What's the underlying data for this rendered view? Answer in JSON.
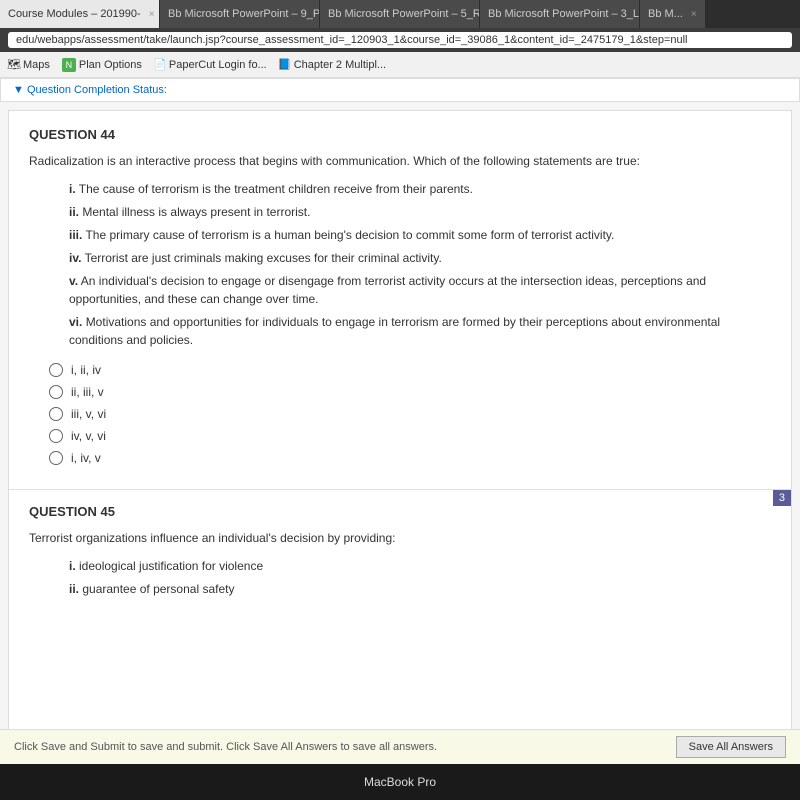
{
  "browser": {
    "tabs": [
      {
        "label": "Course Modules – 201990-",
        "active": true,
        "close": "×"
      },
      {
        "label": "Bb Microsoft PowerPoint – 9_P...",
        "active": false,
        "close": "×"
      },
      {
        "label": "Bb Microsoft PowerPoint – 5_R...",
        "active": false,
        "close": "×"
      },
      {
        "label": "Bb Microsoft PowerPoint – 3_L...",
        "active": false,
        "close": "×"
      },
      {
        "label": "Bb M...",
        "active": false,
        "close": "×"
      }
    ],
    "address": "edu/webapps/assessment/take/launch.jsp?course_assessment_id=_120903_1&course_id=_39086_1&content_id=_2475179_1&step=null",
    "bookmarks": [
      {
        "label": "Maps",
        "icon": "🗺"
      },
      {
        "label": "Plan Options",
        "icon": "🅝"
      },
      {
        "label": "PaperCut Login fo...",
        "icon": "📄"
      },
      {
        "label": "Chapter 2 Multipl...",
        "icon": "📘"
      }
    ]
  },
  "page": {
    "completion_status": "▼ Question Completion Status:",
    "questions": [
      {
        "number": "QUESTION 44",
        "text": "Radicalization is an interactive process that begins with communication. Which of the following statements are true:",
        "statements": [
          {
            "label": "i.",
            "text": "The cause of terrorism is the treatment children receive from their parents."
          },
          {
            "label": "ii.",
            "text": "Mental illness is always present in terrorist."
          },
          {
            "label": "iii.",
            "text": "The primary cause of terrorism is a human being's decision to commit some form of terrorist activity."
          },
          {
            "label": "iv.",
            "text": "Terrorist are just criminals making excuses for their criminal activity."
          },
          {
            "label": "v.",
            "text": "An individual's decision to engage or disengage from terrorist activity occurs at the intersection ideas, perceptions and opportunities, and these can change over time."
          },
          {
            "label": "vi.",
            "text": "Motivations and opportunities for individuals to engage in terrorism are formed by their perceptions about environmental conditions and policies."
          }
        ],
        "options": [
          {
            "label": "i, ii, iv"
          },
          {
            "label": "ii, iii, v"
          },
          {
            "label": "iii, v, vi"
          },
          {
            "label": "iv, v, vi"
          },
          {
            "label": "i, iv, v"
          }
        ]
      },
      {
        "number": "QUESTION 45",
        "badge": "3",
        "text": "Terrorist organizations influence an individual's decision by providing:",
        "statements": [
          {
            "label": "i.",
            "text": "ideological justification for violence"
          },
          {
            "label": "ii.",
            "text": "guarantee of personal safety"
          }
        ]
      }
    ],
    "footer": {
      "instruction": "Click Save and Submit to save and submit. Click Save All Answers to save all answers.",
      "save_button": "Save All Answers"
    },
    "taskbar_label": "MacBook Pro"
  }
}
